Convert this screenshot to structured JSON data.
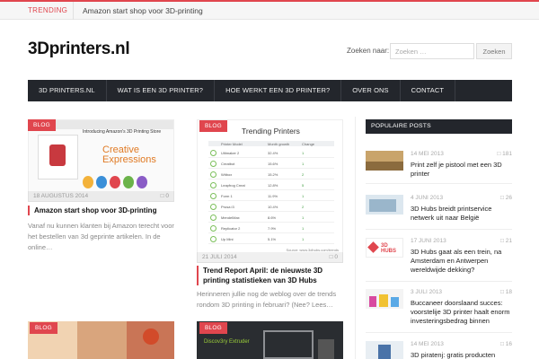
{
  "trending": {
    "label": "TRENDING",
    "text": "Amazon start shop voor 3D-printing"
  },
  "site": {
    "logo": "3Dprinters.nl"
  },
  "search": {
    "label": "Zoeken naar:",
    "placeholder": "Zoeken …",
    "button": "Zoeken"
  },
  "nav": {
    "items": [
      "3D PRINTERS.NL",
      "WAT IS EEN 3D PRINTER?",
      "HOE WERKT EEN 3D PRINTER?",
      "OVER ONS",
      "CONTACT"
    ]
  },
  "posts": [
    {
      "badge": "BLOG",
      "date": "18 AUGUSTUS 2014",
      "comments": "0",
      "title": "Amazon start shop voor 3D-printing",
      "excerpt": "Vanaf nu kunnen klanten  bij Amazon terecht voor het bestellen van 3d geprinte artikelen. In de online…"
    },
    {
      "badge": "BLOG",
      "date": "21 JULI 2014",
      "comments": "0",
      "title": "Trend Report April: de nieuwste 3D printing statistieken van 3D Hubs",
      "excerpt": "Herinneren jullie nog de weblog over de trends rondom 3D printing in februari? (Nee? Lees…",
      "image_title": "Trending Printers"
    },
    {
      "badge": "BLOG"
    },
    {
      "badge": "BLOG",
      "image_caption": "Discov3ry Extruder"
    }
  ],
  "amazon_thumb": {
    "headline": "Creative Expressions",
    "subline": "Introducing Amazon's 3D Printing Store"
  },
  "trending_table": {
    "headers": [
      "Printer Model",
      "Month growth",
      "Change"
    ],
    "rows": [
      {
        "name": "Ultimaker 2",
        "growth": "32.4%",
        "change": "1"
      },
      {
        "name": "Creatbot",
        "growth": "15.6%",
        "change": "1"
      },
      {
        "name": "Witbox",
        "growth": "15.2%",
        "change": "2"
      },
      {
        "name": "Leapfrog Creat",
        "growth": "12.8%",
        "change": "5"
      },
      {
        "name": "Form 1",
        "growth": "11.9%",
        "change": "1"
      },
      {
        "name": "Prusa i3",
        "growth": "10.4%",
        "change": "2"
      },
      {
        "name": "MendelMax",
        "growth": "8.6%",
        "change": "1"
      },
      {
        "name": "Replicator 2",
        "growth": "7.9%",
        "change": "1"
      },
      {
        "name": "Up Mini",
        "growth": "5.1%",
        "change": "1"
      }
    ],
    "source": "Source: www.3dhubs.com/trends"
  },
  "sidebar": {
    "title": "POPULAIRE POSTS",
    "items": [
      {
        "date": "14 MEI 2013",
        "count": "181",
        "title": "Print zelf je pistool met een 3D printer"
      },
      {
        "date": "4 JUNI 2013",
        "count": "26",
        "title": "3D Hubs breidt printservice netwerk uit naar België"
      },
      {
        "date": "17 JUNI 2013",
        "count": "21",
        "title": "3D Hubs gaat als een trein, na Amsterdam en Antwerpen wereldwijde dekking?",
        "thumb_text": "3D HUBS"
      },
      {
        "date": "3 JULI 2013",
        "count": "18",
        "title": "Buccaneer doorslaand succes: voorstelije 3D printer haalt enorm investeringsbedrag binnen"
      },
      {
        "date": "14 MEI 2013",
        "count": "16",
        "title": "3D piratenj: gratis producten"
      }
    ]
  },
  "colors": {
    "accent": "#e0464e",
    "nav_bg": "#23262c"
  }
}
